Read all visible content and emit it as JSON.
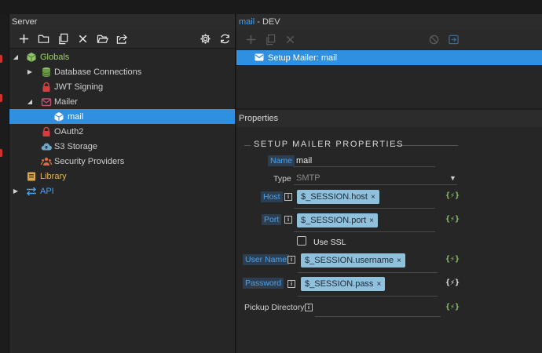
{
  "colors": {
    "accent": "#2f8fe0",
    "binding_pill": "#8fc1dd",
    "dynamic_icon": "#8fc46a",
    "globals_icon": "#8fc46a",
    "library_icon": "#d9a650",
    "mailer_icon": "#c0506e",
    "lock_icon": "#d04040"
  },
  "left_panel": {
    "title": "Server",
    "toolbar": [
      "add-icon",
      "folder-icon",
      "copy-icon",
      "delete-icon",
      "open-folder-icon",
      "share-icon",
      "gear-icon",
      "refresh-icon"
    ],
    "tree": [
      {
        "label": "Globals",
        "icon": "cube-icon",
        "expanded": true
      },
      {
        "label": "Database Connections",
        "icon": "database-icon",
        "expanded": false
      },
      {
        "label": "JWT Signing",
        "icon": "lock-icon"
      },
      {
        "label": "Mailer",
        "icon": "mail-icon",
        "expanded": true
      },
      {
        "label": "mail",
        "icon": "box-icon",
        "selected": true
      },
      {
        "label": "OAuth2",
        "icon": "lock-icon"
      },
      {
        "label": "S3 Storage",
        "icon": "cloud-upload-icon"
      },
      {
        "label": "Security Providers",
        "icon": "users-icon"
      },
      {
        "label": "Library",
        "icon": "library-icon"
      },
      {
        "label": "API",
        "icon": "api-arrows-icon",
        "expanded": false
      }
    ]
  },
  "right_panel": {
    "title_name": "mail",
    "title_env": " - DEV",
    "toolbar": [
      "add-icon",
      "copy-icon",
      "delete-icon",
      "disable-icon",
      "enter-icon"
    ],
    "steps": [
      {
        "label": "Setup Mailer: mail",
        "icon": "mail-icon"
      }
    ]
  },
  "properties": {
    "header": "Properties",
    "section_title": "SETUP MAILER PROPERTIES",
    "name": {
      "label": "Name",
      "value": "mail"
    },
    "type": {
      "label": "Type",
      "value": "SMTP"
    },
    "host": {
      "label": "Host",
      "value": "$_SESSION.host"
    },
    "port": {
      "label": "Port",
      "value": "$_SESSION.port"
    },
    "use_ssl": {
      "label": "Use SSL",
      "checked": false
    },
    "username": {
      "label": "User Name",
      "value": "$_SESSION.username"
    },
    "password": {
      "label": "Password",
      "value": "$_SESSION.pass"
    },
    "pickup_directory": {
      "label": "Pickup Directory",
      "value": ""
    },
    "info_glyph": "i",
    "remove_glyph": "×",
    "dyn_glyph": "{⚡}"
  }
}
